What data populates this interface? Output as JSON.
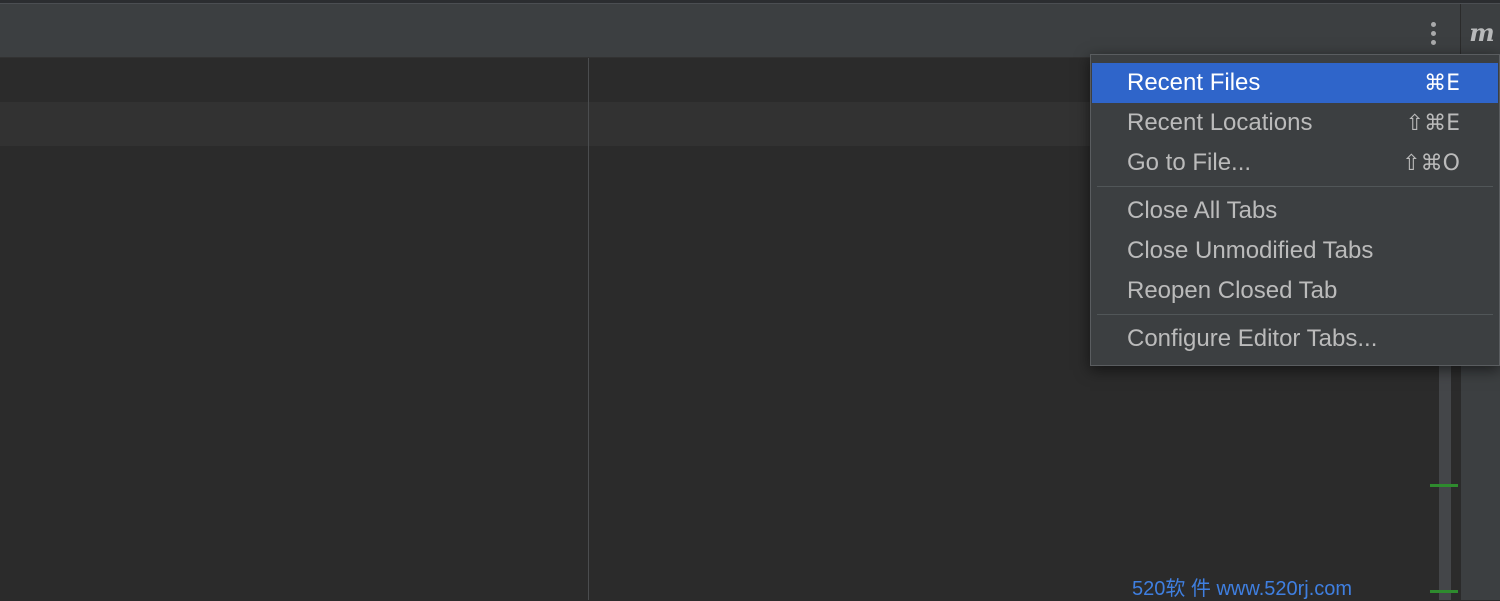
{
  "toolbar": {
    "more_icon": "vertical-ellipsis-icon",
    "plugin_icon_letter": "m"
  },
  "popup_menu": {
    "items": [
      {
        "label": "Recent Files",
        "shortcut": "⌘E",
        "selected": true
      },
      {
        "label": "Recent Locations",
        "shortcut": "⇧⌘E"
      },
      {
        "label": "Go to File...",
        "shortcut": "⇧⌘O"
      },
      {
        "label": "Close All Tabs",
        "shortcut": ""
      },
      {
        "label": "Close Unmodified Tabs",
        "shortcut": ""
      },
      {
        "label": "Reopen Closed Tab",
        "shortcut": ""
      },
      {
        "label": "Configure Editor Tabs...",
        "shortcut": ""
      }
    ]
  },
  "watermark": "520软 件 www.520rj.com",
  "colors": {
    "editor_bg": "#2b2b2b",
    "panel_bg": "#3c3f41",
    "selection": "#2f65ca",
    "menu_text": "#bbbbbb",
    "marker": "#2e8b2e",
    "watermark": "#3f7fe0"
  }
}
